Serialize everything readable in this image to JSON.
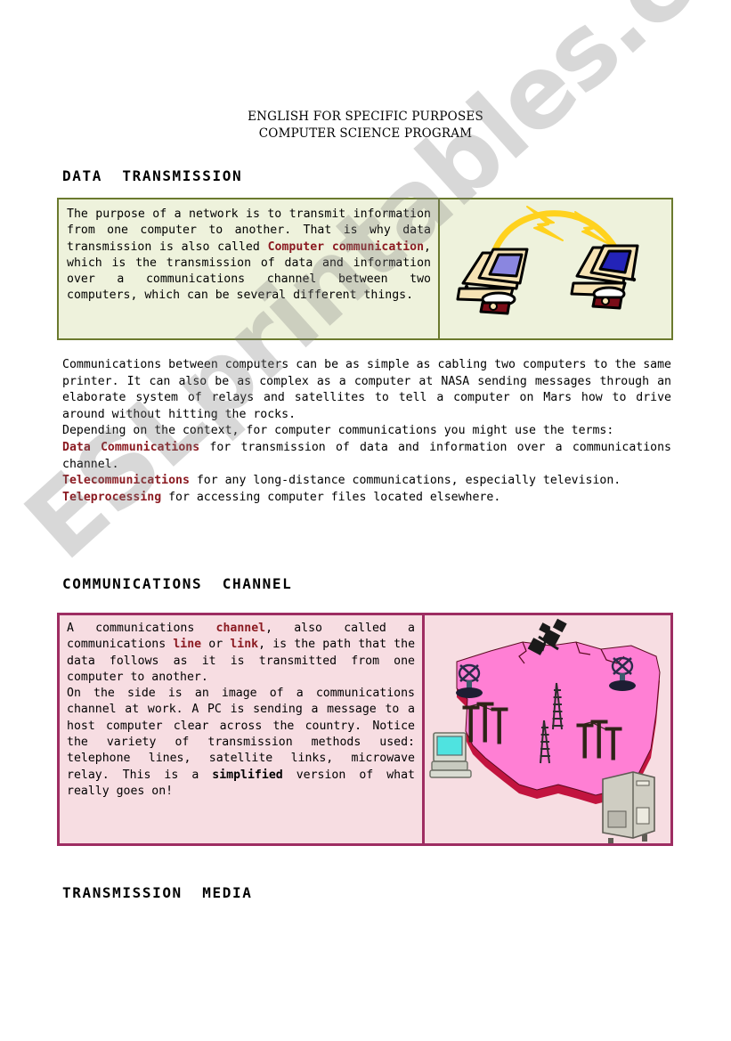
{
  "document": {
    "header_line1": "ENGLISH FOR SPECIFIC PURPOSES",
    "header_line2": "COMPUTER SCIENCE PROGRAM",
    "watermark": "ESLprintables.com"
  },
  "sections": {
    "data_transmission_title": "DATA  TRANSMISSION",
    "communications_channel_title": "COMMUNICATIONS  CHANNEL",
    "transmission_media_title": "TRANSMISSION  MEDIA"
  },
  "green_panel": {
    "text_part1": "The purpose of a network is to transmit information from one computer to another. That is why data transmission is also called ",
    "highlight": "Computer communication",
    "text_part2": ", which is the transmission of data and information over a communications channel between two computers, which can be several different things.",
    "image_name": "two-computers-wireless-link",
    "background": "#eef2dc",
    "border_color": "#6b7a2e"
  },
  "free_text": {
    "paragraph1": "Communications between computers can be as simple as cabling two computers to the same printer. It can also be as complex as a computer at NASA sending messages through an elaborate system of relays and satellites to tell a computer on Mars how to drive around without hitting the rocks.",
    "paragraph2": "Depending on the context, for computer communications you might use the terms:",
    "terms": [
      {
        "term": "Data Communications",
        "definition": " for transmission of data and information over a communications channel."
      },
      {
        "term": "Telecommunications",
        "definition": " for any long-distance communications, especially television."
      },
      {
        "term": "Teleprocessing",
        "definition": " for accessing computer files located elsewhere."
      }
    ],
    "term_color": "#8b1a21"
  },
  "pink_panel": {
    "p1_a": "A communications ",
    "p1_b": "channel",
    "p1_c": ", also called a communications ",
    "p1_d": "line",
    "p1_e": " or ",
    "p1_f": "link",
    "p1_g": ", is the path that the data follows as it is transmitted from one computer to another.",
    "p2_a": "On the side is an image of a communications channel at work. A PC is sending a message to a host computer clear across the country. Notice the variety of transmission methods used: telephone lines, satellite links, microwave relay. This is a ",
    "p2_b": "simplified",
    "p2_c": " version of what really goes on!",
    "image_name": "us-map-communications-channel",
    "background": "#f7dde2",
    "border_color": "#9e2d62",
    "map_fill": "#ff7fd4",
    "map_side": "#c2143f"
  }
}
